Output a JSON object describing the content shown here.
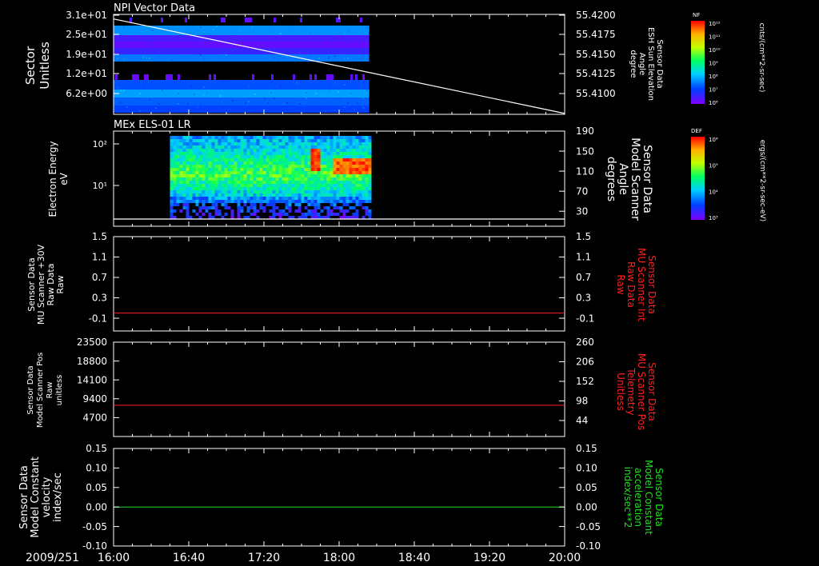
{
  "colors": {
    "background": "#000000",
    "axis": "#ffffff",
    "red_trace": "#ff2020",
    "green_trace": "#20e020",
    "sector_left_bar": "#7f00ff"
  },
  "time_axis": {
    "date_label": "2009/251",
    "ticks": [
      "16:00",
      "16:40",
      "17:20",
      "18:00",
      "18:40",
      "19:20",
      "20:00"
    ],
    "range": [
      "16:00",
      "20:00"
    ]
  },
  "chart_data": [
    {
      "type": "heatmap",
      "title": "NPI Vector Data",
      "ylabel": [
        "Sector",
        "Unitless"
      ],
      "yticks": [
        "3.1e+01",
        "2.5e+01",
        "1.9e+01",
        "1.2e+01",
        "6.2e+00"
      ],
      "ylim": [
        0,
        31
      ],
      "data_extent": {
        "start": "16:00",
        "end": "18:16"
      },
      "y2label": [
        "Sensor Data",
        "ESH Sun Elevation",
        "Angle",
        "degree"
      ],
      "y2ticks": [
        "55.4200",
        "55.4175",
        "55.4150",
        "55.4125",
        "55.4100"
      ],
      "y2lim": [
        55.409,
        55.42
      ],
      "line_series": {
        "name": "ESH Sun Elevation Angle",
        "x": [
          "16:00",
          "20:00"
        ],
        "y": [
          55.4195,
          55.4091
        ]
      },
      "colorbar": {
        "label": "NF",
        "ticks": [
          "10¹²",
          "10¹¹",
          "10¹⁰",
          "10⁹",
          "10⁸",
          "10⁷",
          "10⁶"
        ],
        "units": "cnts/(cm**2-sr-sec)"
      }
    },
    {
      "type": "heatmap",
      "title": "MEx ELS-01 LR",
      "ylabel": [
        "Electron Energy",
        "eV"
      ],
      "yticks": [
        "10²",
        "10¹"
      ],
      "data_extent": {
        "start": "16:30",
        "end": "18:16"
      },
      "y2label": [
        "Sensor Data",
        "Model Scanner",
        "Angle",
        "degrees"
      ],
      "y2ticks": [
        "190",
        "150",
        "110",
        "70",
        "30"
      ],
      "y2lim": [
        0,
        190
      ],
      "line_series": {
        "name": "Model Scanner Angle",
        "x": [
          "16:00",
          "20:00"
        ],
        "y": [
          2,
          2
        ]
      },
      "colorbar": {
        "label": "DEF",
        "ticks": [
          "10⁶",
          "10⁵",
          "10⁴",
          "10³"
        ],
        "units": "ergs/(cm**2-sr-sec-eV)"
      }
    },
    {
      "type": "line",
      "ylabel": [
        "Sensor Data",
        "MU Scanner +30V",
        "Raw Data",
        "Raw"
      ],
      "yticks": [
        "1.5",
        "1.1",
        "0.7",
        "0.3",
        "-0.1"
      ],
      "ylim": [
        -0.35,
        1.5
      ],
      "y2label": [
        "Sensor Data",
        "MU Scanner Int",
        "Raw Data",
        "Raw"
      ],
      "y2ticks": [
        "1.5",
        "1.1",
        "0.7",
        "0.3",
        "-0.1"
      ],
      "series": [
        {
          "x": [
            "16:00",
            "20:00"
          ],
          "values": [
            0.0,
            0.0
          ],
          "color": "#ff2020"
        }
      ]
    },
    {
      "type": "line",
      "ylabel": [
        "Sensor Data",
        "Model Scanner Pos",
        "Raw",
        "unitless"
      ],
      "yticks": [
        "23500",
        "18800",
        "14100",
        "9400",
        "4700"
      ],
      "ylim": [
        0,
        23500
      ],
      "y2label": [
        "Sensor Data",
        "MU Scanner Pos",
        "Telemetry",
        "Unitless"
      ],
      "y2ticks": [
        "260",
        "206",
        "152",
        "98",
        "44"
      ],
      "y2lim": [
        0,
        260
      ],
      "series": [
        {
          "x": [
            "16:00",
            "20:00"
          ],
          "values": [
            7800,
            7800
          ],
          "color": "#ff2020"
        }
      ]
    },
    {
      "type": "line",
      "ylabel": [
        "Sensor Data",
        "Model Constant",
        "velocity",
        "index/sec"
      ],
      "yticks": [
        "0.15",
        "0.10",
        "0.05",
        "0.00",
        "-0.05",
        "-0.10"
      ],
      "ylim": [
        -0.1,
        0.15
      ],
      "y2label": [
        "Sensor Data",
        "Model Constant",
        "acceleration",
        "index/sec**2"
      ],
      "y2ticks": [
        "0.15",
        "0.10",
        "0.05",
        "0.00",
        "-0.05",
        "-0.10"
      ],
      "y2lim": [
        -0.1,
        0.15
      ],
      "series": [
        {
          "x": [
            "16:00",
            "20:00"
          ],
          "values": [
            0.0,
            0.0
          ],
          "color": "#20e020"
        }
      ]
    }
  ]
}
